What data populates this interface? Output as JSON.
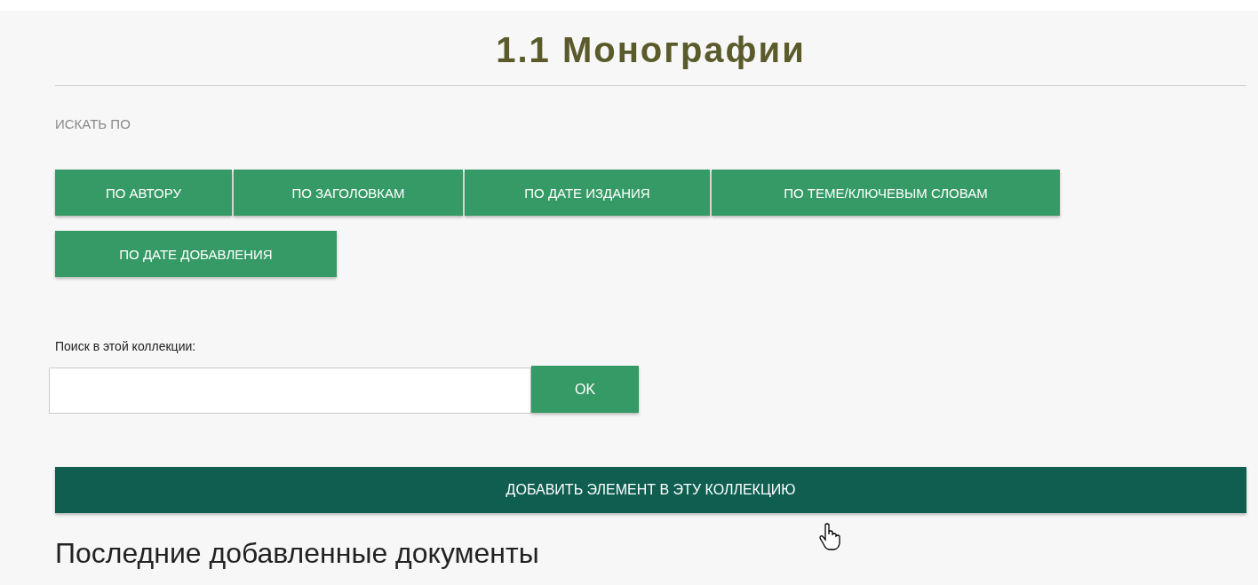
{
  "title": "1.1 Монографии",
  "browse_label": "ИСКАТЬ ПО",
  "browse_buttons": [
    {
      "label": "ПО АВТОРУ"
    },
    {
      "label": "ПО ЗАГОЛОВКАМ"
    },
    {
      "label": "ПО ДАТЕ ИЗДАНИЯ"
    },
    {
      "label": "ПО ТЕМЕ/КЛЮЧЕВЫМ СЛОВАМ"
    },
    {
      "label": "ПО ДАТЕ ДОБАВЛЕНИЯ"
    }
  ],
  "search": {
    "label": "Поиск в этой коллекции:",
    "button": "OK"
  },
  "add_button": "ДОБАВИТЬ ЭЛЕМЕНТ В ЭТУ КОЛЛЕКЦИЮ",
  "recent_heading": "Последние добавленные документы"
}
